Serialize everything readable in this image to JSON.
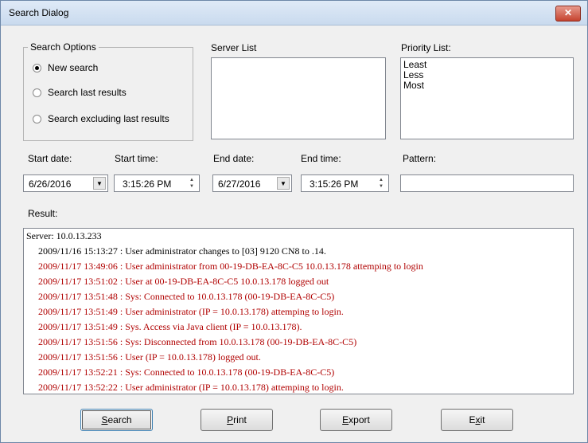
{
  "window": {
    "title": "Search Dialog",
    "close_glyph": "✕"
  },
  "search_options": {
    "legend": "Search Options",
    "options": [
      {
        "label": "New search",
        "selected": true
      },
      {
        "label": "Search last results",
        "selected": false
      },
      {
        "label": "Search excluding last results",
        "selected": false
      }
    ]
  },
  "server_list": {
    "label": "Server List",
    "items": []
  },
  "priority_list": {
    "label": "Priority List:",
    "items": [
      "Least",
      "Less",
      "Most"
    ]
  },
  "filters": {
    "start_date_label": "Start date:",
    "start_date": "6/26/2016",
    "start_time_label": "Start time:",
    "start_time": "3:15:26 PM",
    "end_date_label": "End date:",
    "end_date": "6/27/2016",
    "end_time_label": "End time:",
    "end_time": "3:15:26 PM",
    "pattern_label": "Pattern:",
    "pattern": ""
  },
  "result": {
    "label": "Result:",
    "header": "Server: 10.0.13.233",
    "lines": [
      {
        "text": "2009/11/16 15:13:27 : User administrator changes to [03] 9120 CN8 to .14.",
        "color": "#000000"
      },
      {
        "text": "2009/11/17 13:49:06 : User administrator from 00-19-DB-EA-8C-C5 10.0.13.178 attemping to login",
        "color": "#b00000"
      },
      {
        "text": "2009/11/17 13:51:02 : User at 00-19-DB-EA-8C-C5 10.0.13.178 logged out",
        "color": "#b00000"
      },
      {
        "text": "2009/11/17 13:51:48 : Sys: Connected to 10.0.13.178 (00-19-DB-EA-8C-C5)",
        "color": "#b00000"
      },
      {
        "text": "2009/11/17 13:51:49 : User administrator (IP = 10.0.13.178) attemping to login.",
        "color": "#b00000"
      },
      {
        "text": "2009/11/17 13:51:49 : Sys. Access via Java client (IP = 10.0.13.178).",
        "color": "#b00000"
      },
      {
        "text": "2009/11/17 13:51:56 : Sys: Disconnected from 10.0.13.178 (00-19-DB-EA-8C-C5)",
        "color": "#b00000"
      },
      {
        "text": "2009/11/17 13:51:56 : User  (IP = 10.0.13.178) logged out.",
        "color": "#b00000"
      },
      {
        "text": "2009/11/17 13:52:21 : Sys: Connected to 10.0.13.178 (00-19-DB-EA-8C-C5)",
        "color": "#b00000"
      },
      {
        "text": "2009/11/17 13:52:22 : User administrator (IP = 10.0.13.178) attemping to login.",
        "color": "#b00000"
      }
    ]
  },
  "buttons": {
    "search": {
      "underline": "S",
      "rest": "earch"
    },
    "print": {
      "underline": "P",
      "rest": "rint"
    },
    "export": {
      "underline": "E",
      "rest": "xport"
    },
    "exit": {
      "pre": "E",
      "underline": "x",
      "rest": "it"
    }
  },
  "icons": {
    "dropdown": "dropdown-arrow-icon",
    "spin": "spin-arrows-icon",
    "close": "close-icon",
    "radio": "radio-icon"
  }
}
